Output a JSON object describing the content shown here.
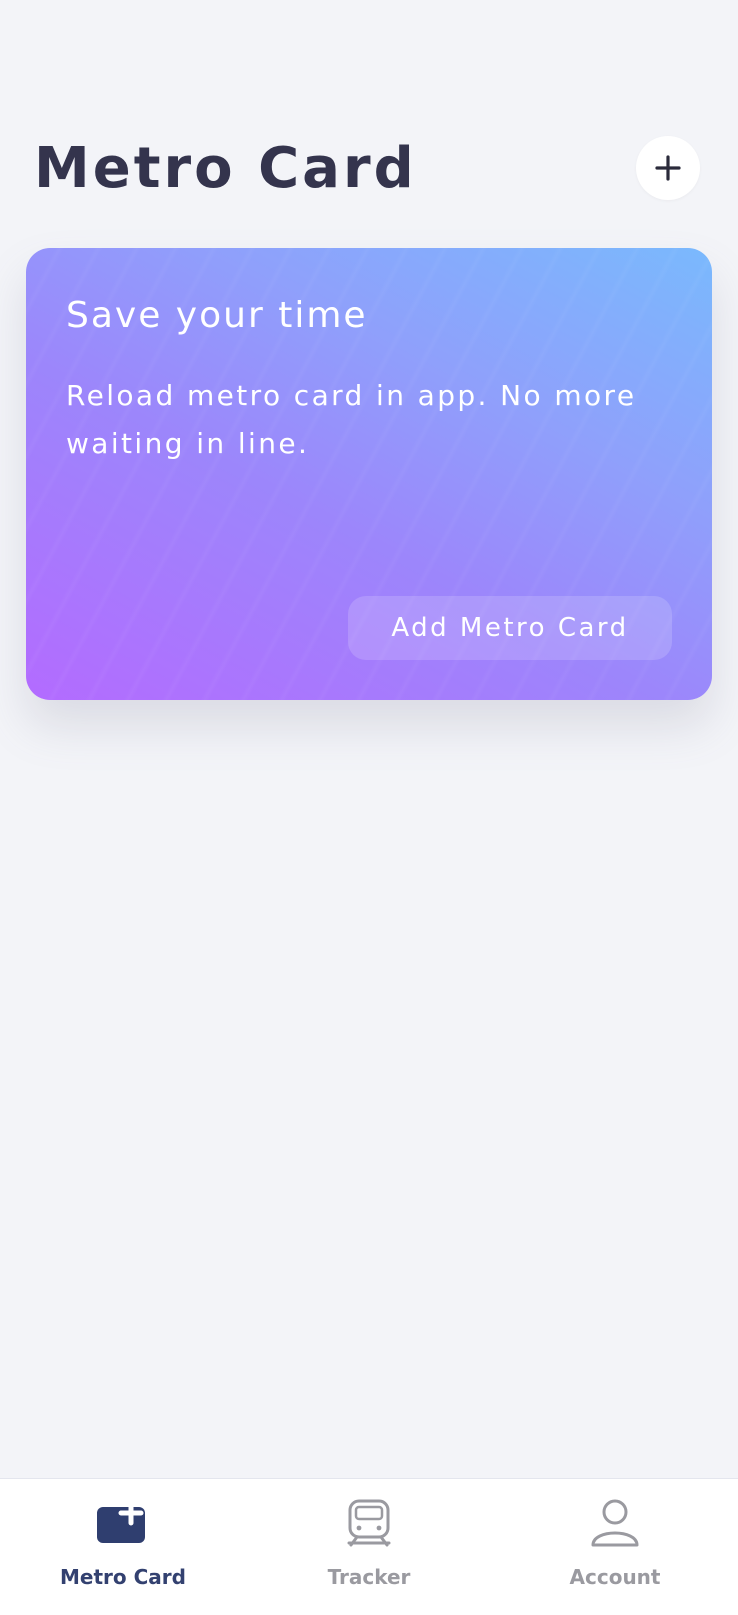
{
  "header": {
    "title": "Metro Card",
    "add_icon": "plus-icon"
  },
  "promo": {
    "title": "Save your time",
    "description": "Reload metro card in app. No more waiting in line.",
    "button_label": "Add Metro Card",
    "gradient_colors": [
      "#b36bff",
      "#9c86fb",
      "#8fa0fb",
      "#7ab9fd"
    ]
  },
  "tabs": [
    {
      "label": "Metro Card",
      "icon": "metro-card-icon",
      "active": true
    },
    {
      "label": "Tracker",
      "icon": "train-icon",
      "active": false
    },
    {
      "label": "Account",
      "icon": "user-icon",
      "active": false
    }
  ],
  "colors": {
    "background": "#f3f4f8",
    "title": "#34344d",
    "tab_active": "#334170",
    "tab_inactive": "#9a9aa0"
  }
}
